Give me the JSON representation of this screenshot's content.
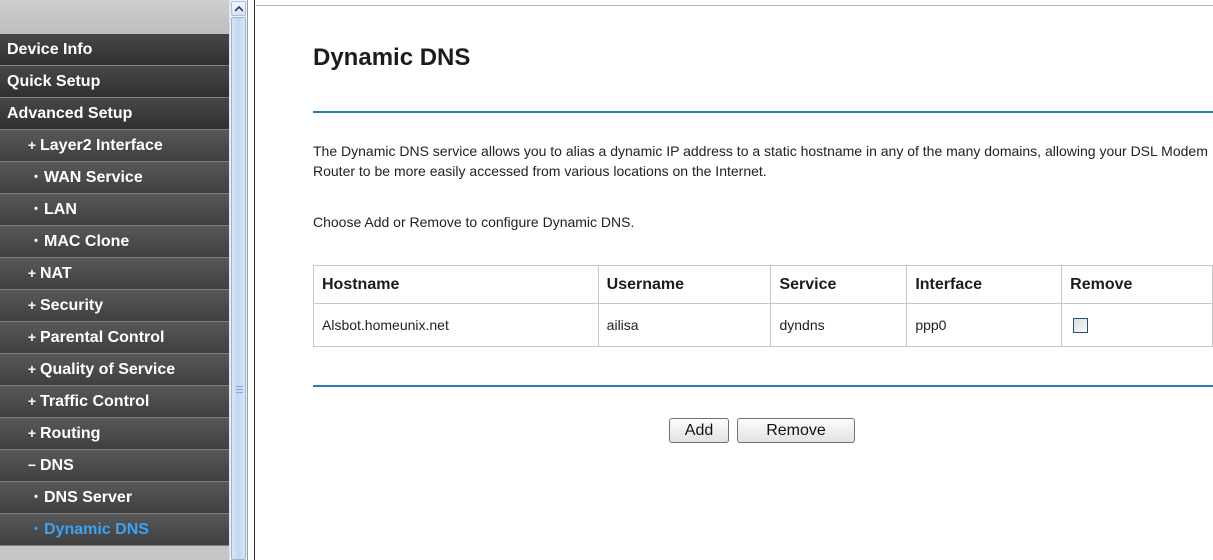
{
  "sidebar": {
    "items": [
      {
        "label": "Device Info",
        "mark": ""
      },
      {
        "label": "Quick Setup",
        "mark": ""
      },
      {
        "label": "Advanced Setup",
        "mark": ""
      },
      {
        "label": "Layer2 Interface",
        "mark": "+"
      },
      {
        "label": "WAN Service",
        "mark": "•"
      },
      {
        "label": "LAN",
        "mark": "•"
      },
      {
        "label": "MAC Clone",
        "mark": "•"
      },
      {
        "label": "NAT",
        "mark": "+"
      },
      {
        "label": "Security",
        "mark": "+"
      },
      {
        "label": "Parental Control",
        "mark": "+"
      },
      {
        "label": "Quality of Service",
        "mark": "+"
      },
      {
        "label": "Traffic Control",
        "mark": "+"
      },
      {
        "label": "Routing",
        "mark": "+"
      },
      {
        "label": "DNS",
        "mark": "−"
      },
      {
        "label": "DNS Server",
        "mark": "•"
      },
      {
        "label": "Dynamic DNS",
        "mark": "•"
      }
    ],
    "active_item": "Dynamic DNS",
    "active_color": "#3aa3f5"
  },
  "main": {
    "title": "Dynamic DNS",
    "description": "The Dynamic DNS service allows you to alias a dynamic IP address to a static hostname in any of the many domains, allowing your DSL Modem Router to be more easily accessed from various locations on the Internet.",
    "instruction": "Choose Add or Remove to configure Dynamic DNS.",
    "table": {
      "headers": [
        "Hostname",
        "Username",
        "Service",
        "Interface",
        "Remove"
      ],
      "rows": [
        {
          "hostname": "Alsbot.homeunix.net",
          "username": "ailisa",
          "service": "dyndns",
          "interface": "ppp0",
          "remove_checked": false
        }
      ]
    },
    "buttons": {
      "add_label": "Add",
      "remove_label": "Remove"
    },
    "accent_color": "#2c7bb6"
  }
}
